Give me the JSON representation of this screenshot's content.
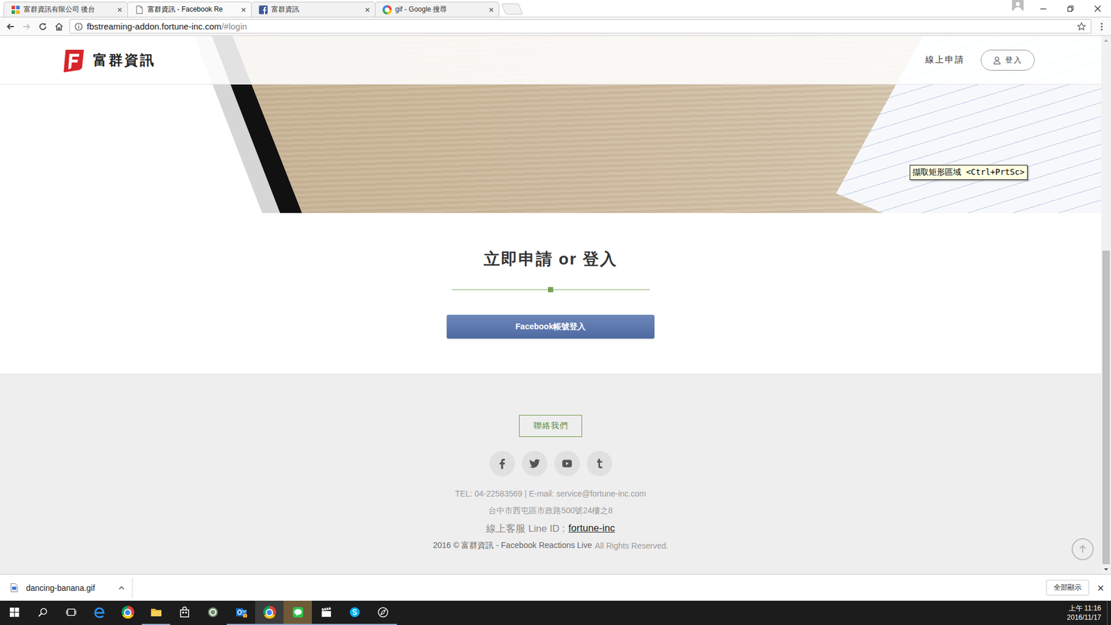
{
  "browser": {
    "tabs": [
      {
        "label": "富群資訊有限公司 後台",
        "icon": "grid",
        "selected": false
      },
      {
        "label": "富群資訊 - Facebook Re",
        "icon": "page",
        "selected": true
      },
      {
        "label": "富群資訊",
        "icon": "facebook",
        "selected": false
      },
      {
        "label": "gif - Google 搜尋",
        "icon": "google",
        "selected": false
      }
    ],
    "address": {
      "host": "fbstreaming-addon.fortune-inc.com",
      "path": "/#login"
    },
    "forward_disabled": true
  },
  "page": {
    "brand": "富群資訊",
    "nav": [
      {
        "label": "線上申請",
        "kind": "link"
      },
      {
        "label": "登入",
        "kind": "button"
      }
    ],
    "tooltip": "擷取矩形區域 <Ctrl+PrtSc>",
    "title": "立即申請 or 登入",
    "login_button": "Facebook帳號登入",
    "contact_button": "聯絡我們",
    "socials": [
      {
        "kind": "facebook"
      },
      {
        "kind": "twitter"
      },
      {
        "kind": "youtube"
      },
      {
        "kind": "tumblr"
      }
    ],
    "contact": "TEL: 04-22583569 | E-mail: service@fortune-inc.com",
    "address": "台中市西屯區市政路500號24樓之8",
    "line_label": "線上客服 Line ID :",
    "line_id": "fortune-inc",
    "copyright_main": "2016 © 富群資訊 - Facebook Reactions Live",
    "copyright_rest": "All Rights Reserved."
  },
  "downloads": {
    "file": "dancing-banana.gif",
    "show_all": "全部顯示",
    "close": "×"
  },
  "taskbar": {
    "apps": [
      {
        "kind": "search",
        "running": false,
        "selected": false,
        "attention": false
      },
      {
        "kind": "taskview",
        "running": false,
        "selected": false,
        "attention": false
      },
      {
        "kind": "edge",
        "running": false,
        "selected": false,
        "attention": false
      },
      {
        "kind": "chrome",
        "running": false,
        "selected": false,
        "attention": false
      },
      {
        "kind": "explorer",
        "running": true,
        "selected": false,
        "attention": false
      },
      {
        "kind": "store",
        "running": false,
        "selected": false,
        "attention": false
      },
      {
        "kind": "green-app",
        "running": false,
        "selected": false,
        "attention": false
      },
      {
        "kind": "outlook",
        "running": true,
        "selected": false,
        "attention": false
      },
      {
        "kind": "chrome",
        "running": true,
        "selected": true,
        "attention": false
      },
      {
        "kind": "line",
        "running": true,
        "selected": false,
        "attention": true
      },
      {
        "kind": "video",
        "running": true,
        "selected": false,
        "attention": false
      },
      {
        "kind": "skype",
        "running": true,
        "selected": false,
        "attention": false
      },
      {
        "kind": "compass",
        "running": true,
        "selected": false,
        "attention": false
      }
    ],
    "time": "上午 11:16",
    "date": "2016/11/17"
  }
}
